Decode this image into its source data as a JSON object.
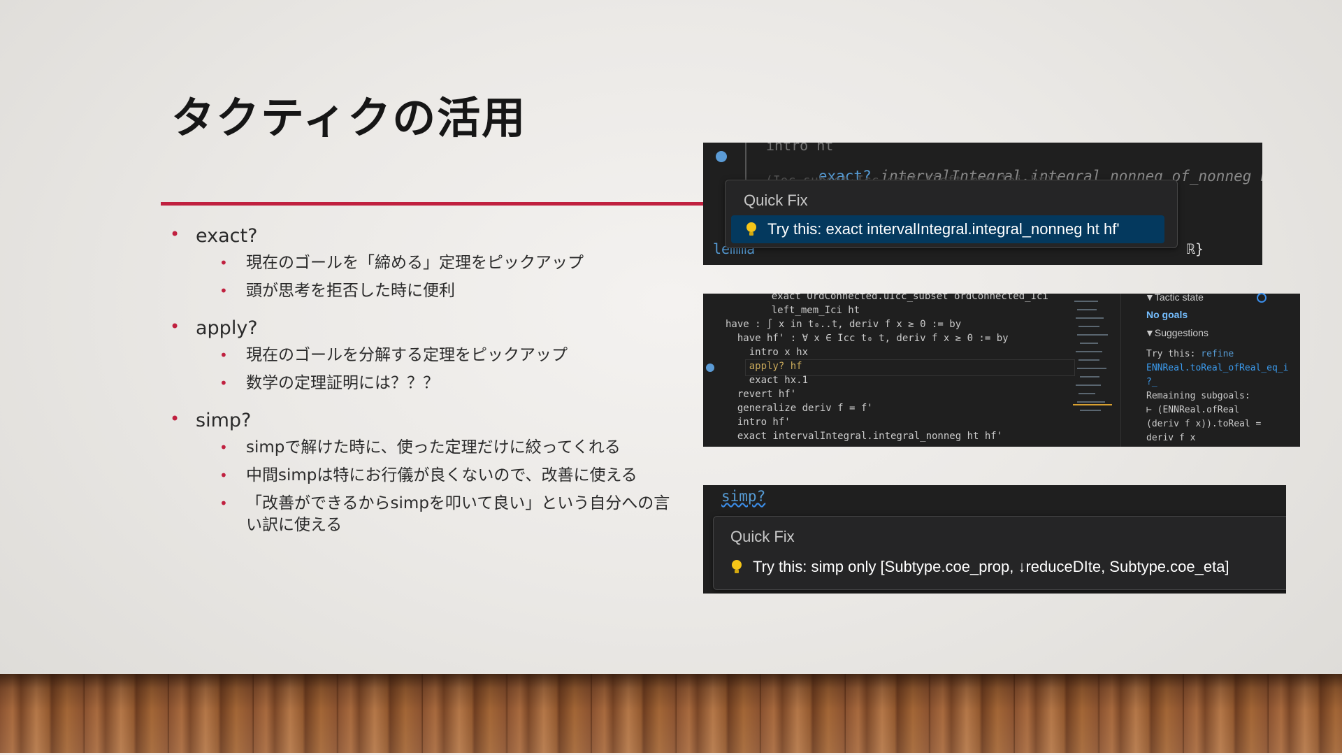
{
  "slide": {
    "title": "タクティクの活用",
    "accent_color": "#c0203f"
  },
  "bullets": [
    {
      "label": "exact?",
      "subs": [
        "現在のゴールを「締める」定理をピックアップ",
        "頭が思考を拒否した時に便利"
      ]
    },
    {
      "label": "apply?",
      "subs": [
        "現在のゴールを分解する定理をピックアップ",
        "数学の定理証明には？？？"
      ]
    },
    {
      "label": "simp?",
      "subs": [
        "simpで解けた時に、使った定理だけに絞ってくれる",
        "中間simpは特にお行儀が良くないので、改善に使える",
        "「改善ができるからsimpを叩いて良い」という自分への言い訳に使える"
      ]
    }
  ],
  "panel1": {
    "top_fragment": "intro ht",
    "code_keyword": "exact?",
    "code_rest": " intervalIntegral.integral_nonneg_of_nonneg hf'",
    "hidden_line": "(Ioc_subset_Icc_self (left_mem_Ioi ht))",
    "lemma_line": "lemma",
    "lemma_tail": "ℝ}",
    "quickfix_title": "Quick Fix",
    "quickfix_item": "Try this: exact intervalIntegral.integral_nonneg ht hf'"
  },
  "panel2": {
    "code_lines": [
      "    exact OrdConnected.uIcc_subset ordConnected_Ici",
      "    left_mem_Ici ht",
      "have : ∫ x in t₀..t, deriv f x ≥ 0 := by",
      "  have hf' : ∀ x ∈ Icc t₀ t, deriv f x ≥ 0 := by",
      "    intro x hx",
      "    apply? hf",
      "    exact hx.1",
      "  revert hf'",
      "  generalize deriv f = f'",
      "  intro hf'",
      "  exact intervalIntegral.integral_nonneg ht hf'"
    ],
    "tactic_state_header": "▼Tactic state",
    "no_goals": "No goals",
    "suggestions_header": "▼Suggestions",
    "suggestion_prefix": "Try this: ",
    "suggestion_keyword": "refine",
    "suggestion_link_1": "ENNReal.toReal_ofReal_eq_i",
    "suggestion_link_2": "?_",
    "remaining": "Remaining subgoals:",
    "subgoal_1": "⊢ (ENNReal.ofReal",
    "subgoal_2": "(deriv f x)).toReal =",
    "subgoal_3": "deriv f x"
  },
  "panel3": {
    "code_line": "simp?",
    "quickfix_title": "Quick Fix",
    "quickfix_item": "Try this: simp only [Subtype.coe_prop, ↓reduceDIte, Subtype.coe_eta]"
  }
}
